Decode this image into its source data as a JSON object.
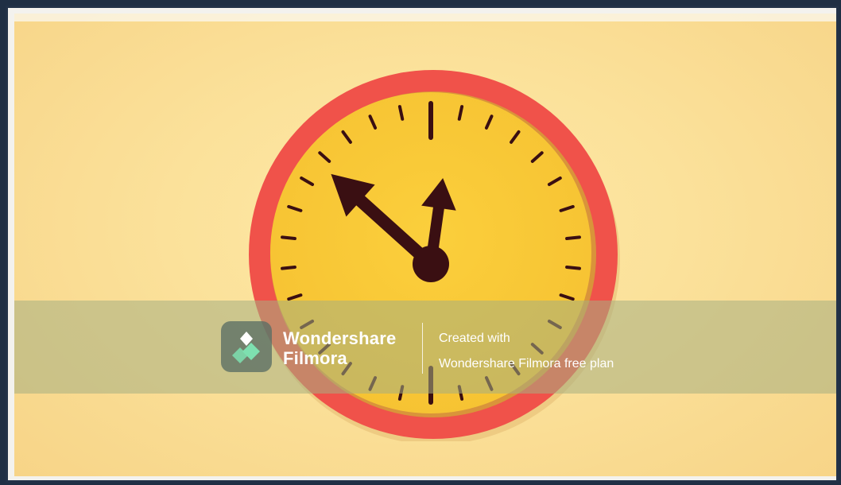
{
  "watermark": {
    "brand_line1": "Wondershare",
    "brand_line2": "Filmora",
    "note_line1": "Created with",
    "note_line2": "Wondershare Filmora free plan"
  },
  "icons": {
    "logo": "filmora-logo-icon",
    "clock": "clock-icon"
  },
  "colors": {
    "background": "#fbe19a",
    "clock_rim": "#f0524a",
    "clock_face": "#f9c938",
    "hands": "#3a0f12",
    "logo_tile": "#5a6e64",
    "logo_accent": "#7ee0b0"
  }
}
